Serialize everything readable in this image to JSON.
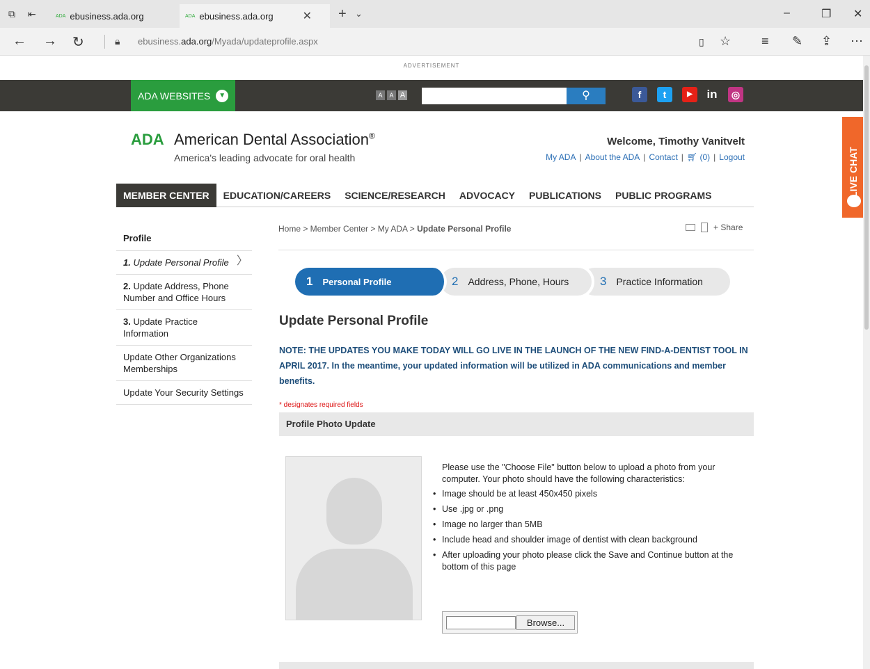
{
  "browser": {
    "tabs": [
      {
        "favicon": "ADA",
        "title": "ebusiness.ada.org"
      },
      {
        "favicon": "ADA",
        "title": "ebusiness.ada.org"
      }
    ],
    "url_host": "ebusiness.",
    "url_domain": "ada.org",
    "url_path": "/Myada/updateprofile.aspx"
  },
  "ad_label": "ADVERTISEMENT",
  "topbar": {
    "websites_label": "ADA WEBSITES",
    "font_sizes": [
      "A",
      "A",
      "A"
    ],
    "search_placeholder": "",
    "social": [
      "f",
      "t",
      "▶",
      "in",
      "◎"
    ]
  },
  "header": {
    "logo_abbr": "ADA",
    "logo_name": "American Dental Association",
    "logo_mark": "®",
    "tagline": "America's leading advocate for oral health",
    "welcome": "Welcome, Timothy Vanitvelt",
    "links": {
      "my_ada": "My ADA",
      "about": "About the ADA",
      "contact": "Contact",
      "cart": "(0)",
      "logout": "Logout"
    }
  },
  "nav": [
    "MEMBER CENTER",
    "EDUCATION/CAREERS",
    "SCIENCE/RESEARCH",
    "ADVOCACY",
    "PUBLICATIONS",
    "PUBLIC PROGRAMS"
  ],
  "live_chat": "LIVE CHAT",
  "sidebar": {
    "title": "Profile",
    "items": [
      {
        "num": "1.",
        "label": "Update Personal Profile"
      },
      {
        "num": "2.",
        "label": "Update Address, Phone Number and Office Hours"
      },
      {
        "num": "3.",
        "label": "Update Practice Information"
      },
      {
        "num": "",
        "label": "Update Other Organizations Memberships"
      },
      {
        "num": "",
        "label": "Update Your Security Settings"
      }
    ]
  },
  "breadcrumb": {
    "trail": "Home > Member Center > My ADA > ",
    "current": "Update Personal Profile",
    "share": "+ Share"
  },
  "steps": [
    {
      "num": "1",
      "label": "Personal Profile"
    },
    {
      "num": "2",
      "label": "Address, Phone, Hours"
    },
    {
      "num": "3",
      "label": "Practice Information"
    }
  ],
  "page_title": "Update Personal Profile",
  "note": "NOTE: THE UPDATES YOU MAKE TODAY WILL GO LIVE IN THE LAUNCH OF THE NEW FIND-A-DENTIST TOOL IN APRIL 2017. In the meantime, your updated information will be utilized in ADA communications and member benefits.",
  "required_note": "* designates required fields",
  "photo_section": {
    "heading": "Profile Photo Update",
    "intro": "Please use the \"Choose File\" button below to upload a photo from your computer. Your photo should have the following characteristics:",
    "bullets": [
      "Image should be at least 450x450 pixels",
      "Use .jpg or .png",
      "Image no larger than 5MB",
      "Include head and shoulder image of dentist with clean background",
      "After uploading your photo please click the Save and Continue button at the bottom of this page"
    ],
    "browse_label": "Browse..."
  },
  "colors": {
    "ada_green": "#2a9d3e",
    "ada_blue": "#1f6eb3",
    "dark_bar": "#3b3a36",
    "live_chat": "#f0672a"
  }
}
